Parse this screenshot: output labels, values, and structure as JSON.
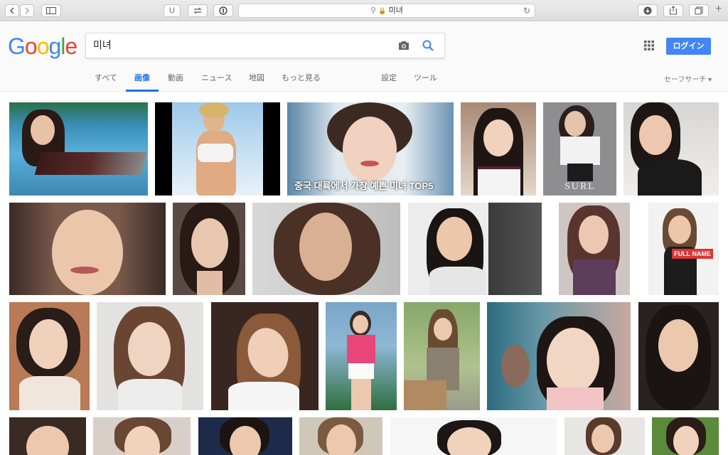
{
  "browser": {
    "address_text": "미녀",
    "reader_label": "U"
  },
  "google": {
    "logo_letters": [
      "G",
      "o",
      "o",
      "g",
      "l",
      "e"
    ],
    "logo_colors": [
      "#4285f4",
      "#ea4335",
      "#fbbc05",
      "#4285f4",
      "#34a853",
      "#ea4335"
    ],
    "search_value": "미녀",
    "login_label": "ログイン",
    "tabs": [
      {
        "label": "すべて"
      },
      {
        "label": "画像"
      },
      {
        "label": "動画"
      },
      {
        "label": "ニュース"
      },
      {
        "label": "地図"
      },
      {
        "label": "もっと見る"
      },
      {
        "label": "設定"
      },
      {
        "label": "ツール"
      }
    ],
    "safe_search_label": "セーフサーチ ▾",
    "active_tab": "画像",
    "accent_color": "#1a73e8"
  },
  "results": {
    "captions": {
      "img_row1_3": "중국 대륙에서 가장 예쁜 미녀 TOP5",
      "img_row1_5": "SURL",
      "img_row2_7": "FULL NAME"
    }
  }
}
